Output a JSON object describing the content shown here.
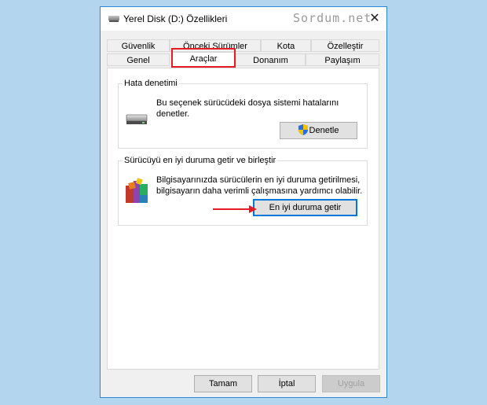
{
  "window": {
    "title": "Yerel Disk (D:) Özellikleri",
    "watermark": "Sordum.net",
    "close_glyph": "✕"
  },
  "tabs_top": [
    "Güvenlik",
    "Önceki Sürümler",
    "Kota",
    "Özelleştir"
  ],
  "tabs_bottom": [
    "Genel",
    "Araçlar",
    "Donanım",
    "Paylaşım"
  ],
  "active_tab": "Araçlar",
  "error_check": {
    "title": "Hata denetimi",
    "description_line1": "Bu seçenek sürücüdeki dosya sistemi hatalarını",
    "description_line2": "denetler.",
    "button_label": "Denetle",
    "icon": "drive-icon"
  },
  "optimize": {
    "title": "Sürücüyü en iyi duruma getir ve birleştir",
    "description_line1": "Bilgisayarınızda sürücülerin en iyi duruma getirilmesi,",
    "description_line2": "bilgisayarın daha verimli çalışmasına yardımcı olabilir.",
    "button_label": "En iyi duruma getir",
    "icon": "defrag-icon"
  },
  "footer": {
    "ok_label": "Tamam",
    "cancel_label": "İptal",
    "apply_label": "Uygula"
  },
  "colors": {
    "accent": "#0078d7",
    "highlight": "#e51c23",
    "desktop": "#b3d6ee"
  }
}
